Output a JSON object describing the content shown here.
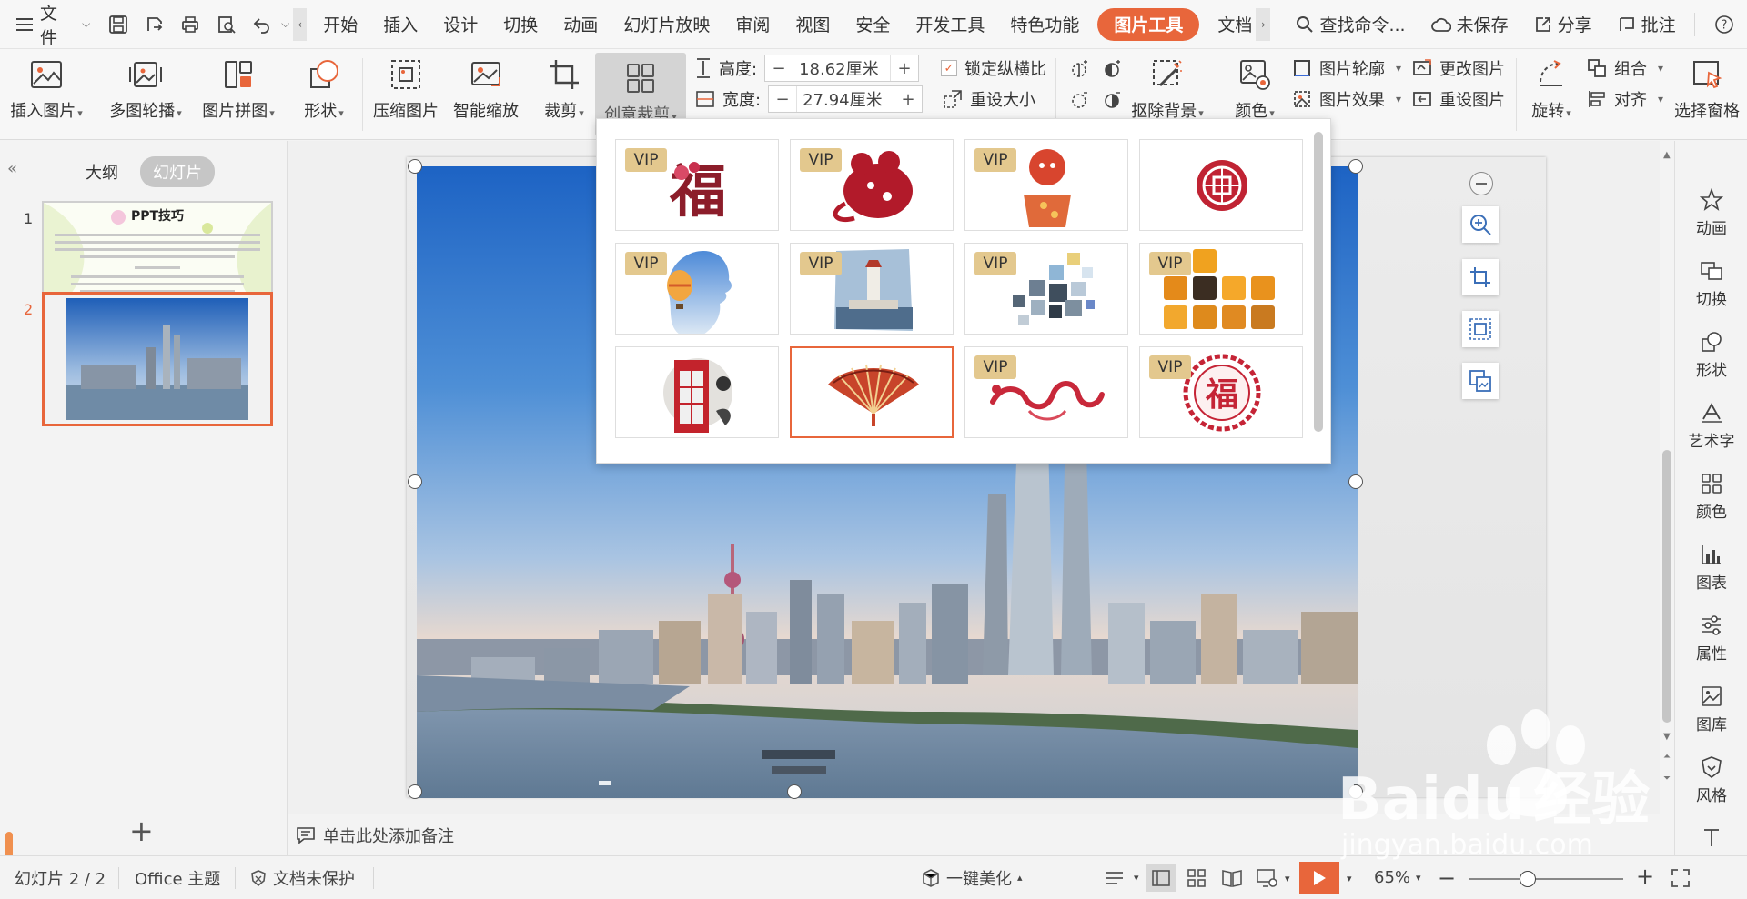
{
  "menubar": {
    "file_label": "文件",
    "tabs": [
      "开始",
      "插入",
      "设计",
      "切换",
      "动画",
      "幻灯片放映",
      "审阅",
      "视图",
      "安全",
      "开发工具",
      "特色功能",
      "图片工具",
      "文档"
    ],
    "active_tab": "图片工具",
    "search_label": "查找命令...",
    "unsaved_label": "未保存",
    "share_label": "分享",
    "review_label": "批注"
  },
  "ribbon": {
    "insert_picture": "插入图片",
    "multi_carousel": "多图轮播",
    "picture_collage": "图片拼图",
    "shape": "形状",
    "compress": "压缩图片",
    "smart_zoom": "智能缩放",
    "crop": "裁剪",
    "creative_crop": "创意裁剪",
    "height_label": "高度:",
    "height_value": "18.62厘米",
    "width_label": "宽度:",
    "width_value": "27.94厘米",
    "lock_ratio": "锁定纵横比",
    "reset_size": "重设大小",
    "remove_bg": "抠除背景",
    "color": "颜色",
    "picture_outline": "图片轮廓",
    "picture_effect": "图片效果",
    "change_picture": "更改图片",
    "reset_picture": "重设图片",
    "rotate": "旋转",
    "group": "组合",
    "align": "对齐",
    "selection_pane": "选择窗格",
    "minus": "−",
    "plus": "+"
  },
  "leftpanel": {
    "outline_tab": "大纲",
    "slides_tab": "幻灯片",
    "slide1_num": "1",
    "slide2_num": "2",
    "slide1_title": "PPT技巧"
  },
  "gallery": {
    "vip_label": "VIP",
    "items": [
      {
        "vip": true,
        "name": "fu-calligraphy"
      },
      {
        "vip": true,
        "name": "rat-papercut"
      },
      {
        "vip": true,
        "name": "child-papercut"
      },
      {
        "vip": false,
        "name": "round-seal"
      },
      {
        "vip": true,
        "name": "profile-balloon"
      },
      {
        "vip": true,
        "name": "lighthouse-brush"
      },
      {
        "vip": true,
        "name": "mosaic-tiles"
      },
      {
        "vip": true,
        "name": "rounded-squares"
      },
      {
        "vip": false,
        "name": "phone-booth"
      },
      {
        "vip": false,
        "name": "folding-fan"
      },
      {
        "vip": true,
        "name": "red-scroll"
      },
      {
        "vip": true,
        "name": "fu-round-seal"
      }
    ]
  },
  "rightbar": {
    "items": [
      "动画",
      "切换",
      "形状",
      "艺术字",
      "颜色",
      "图表",
      "属性",
      "图库",
      "风格"
    ]
  },
  "notes": {
    "placeholder": "单击此处添加备注"
  },
  "status": {
    "slide_info": "幻灯片 2 / 2",
    "theme": "Office 主题",
    "protect": "文档未保护",
    "beautify": "一键美化",
    "zoom": "65%"
  },
  "watermark": {
    "brand": "Baidu",
    "brand_cn": "经验",
    "url": "jingyan.baidu.com"
  },
  "colors": {
    "accent": "#e8663b",
    "vip_gold": "#e3c88e"
  }
}
